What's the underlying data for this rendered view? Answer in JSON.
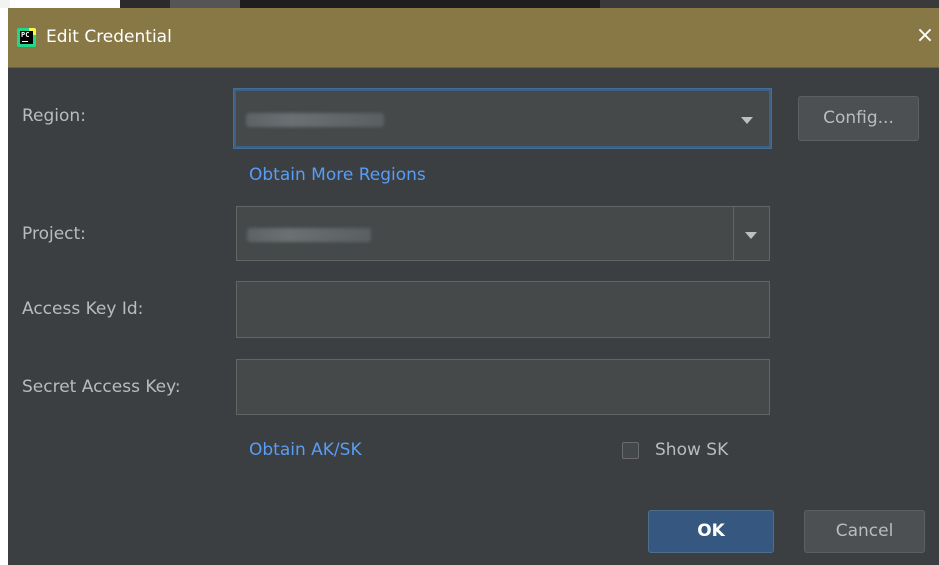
{
  "dialog": {
    "title": "Edit Credential",
    "app_icon_text": "PC",
    "close_glyph": "×"
  },
  "form": {
    "region_label": "Region:",
    "config_button": "Config...",
    "obtain_regions_link": "Obtain More Regions",
    "project_label": "Project:",
    "access_key_label": "Access Key Id:",
    "access_key_value": "",
    "secret_key_label": "Secret Access Key:",
    "secret_key_value": "",
    "obtain_aksk_link": "Obtain AK/SK",
    "show_sk_label": "Show SK",
    "show_sk_checked": false
  },
  "buttons": {
    "ok": "OK",
    "cancel": "Cancel"
  },
  "icons": {
    "app": "pycharm-icon",
    "close": "close-icon",
    "dropdown": "chevron-down-icon"
  },
  "colors": {
    "titlebar": "#877845",
    "dialog_bg": "#3c3f41",
    "link": "#589df6",
    "primary_button": "#365880"
  }
}
